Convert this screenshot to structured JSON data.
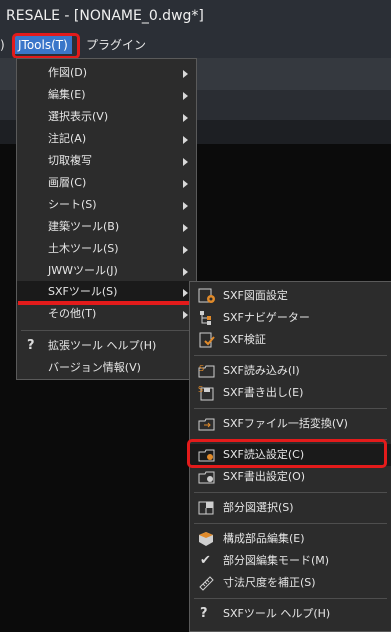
{
  "window": {
    "title": "RESALE - [NONAME_0.dwg*]"
  },
  "menubar": {
    "left_fragment": ")",
    "jtools": "JTools(T)",
    "plugin": "プラグイン"
  },
  "menu": {
    "items": [
      {
        "label": "作図(D)"
      },
      {
        "label": "編集(E)"
      },
      {
        "label": "選択表示(V)"
      },
      {
        "label": "注記(A)"
      },
      {
        "label": "切取複写"
      },
      {
        "label": "画層(C)"
      },
      {
        "label": "シート(S)"
      },
      {
        "label": "建築ツール(B)"
      },
      {
        "label": "土木ツール(S)"
      },
      {
        "label": "JWWツール(J)"
      },
      {
        "label": "SXFツール(S)"
      },
      {
        "label": "その他(T)"
      }
    ],
    "help": "拡張ツール ヘルプ(H)",
    "help_icon": "?",
    "version": "バージョン情報(V)"
  },
  "submenu": {
    "items": [
      {
        "label": "SXF図面設定",
        "icon": "drawing-settings-icon"
      },
      {
        "label": "SXFナビゲーター",
        "icon": "navigator-icon"
      },
      {
        "label": "SXF検証",
        "icon": "verify-icon"
      },
      {
        "label": "SXF読み込み(I)",
        "icon": "import-icon"
      },
      {
        "label": "SXF書き出し(E)",
        "icon": "export-icon"
      },
      {
        "label": "SXFファイル一括変換(V)",
        "icon": "batch-convert-icon"
      },
      {
        "label": "SXF読込設定(C)",
        "icon": "import-settings-icon"
      },
      {
        "label": "SXF書出設定(O)",
        "icon": "export-settings-icon"
      },
      {
        "label": "部分図選択(S)",
        "icon": "partial-select-icon"
      },
      {
        "label": "構成部品編集(E)",
        "icon": "component-edit-icon"
      },
      {
        "label": "部分図編集モード(M)",
        "icon": "checkmark-icon"
      },
      {
        "label": "寸法尺度を補正(S)",
        "icon": "dimension-scale-icon"
      },
      {
        "label": "SXFツール ヘルプ(H)",
        "icon": "help-icon"
      }
    ],
    "help_icon": "?",
    "check_glyph": "✔"
  },
  "colors": {
    "highlight_red": "#e31b1b",
    "menu_bg": "#2c2c2c",
    "jtools_active": "#3a76c9"
  }
}
